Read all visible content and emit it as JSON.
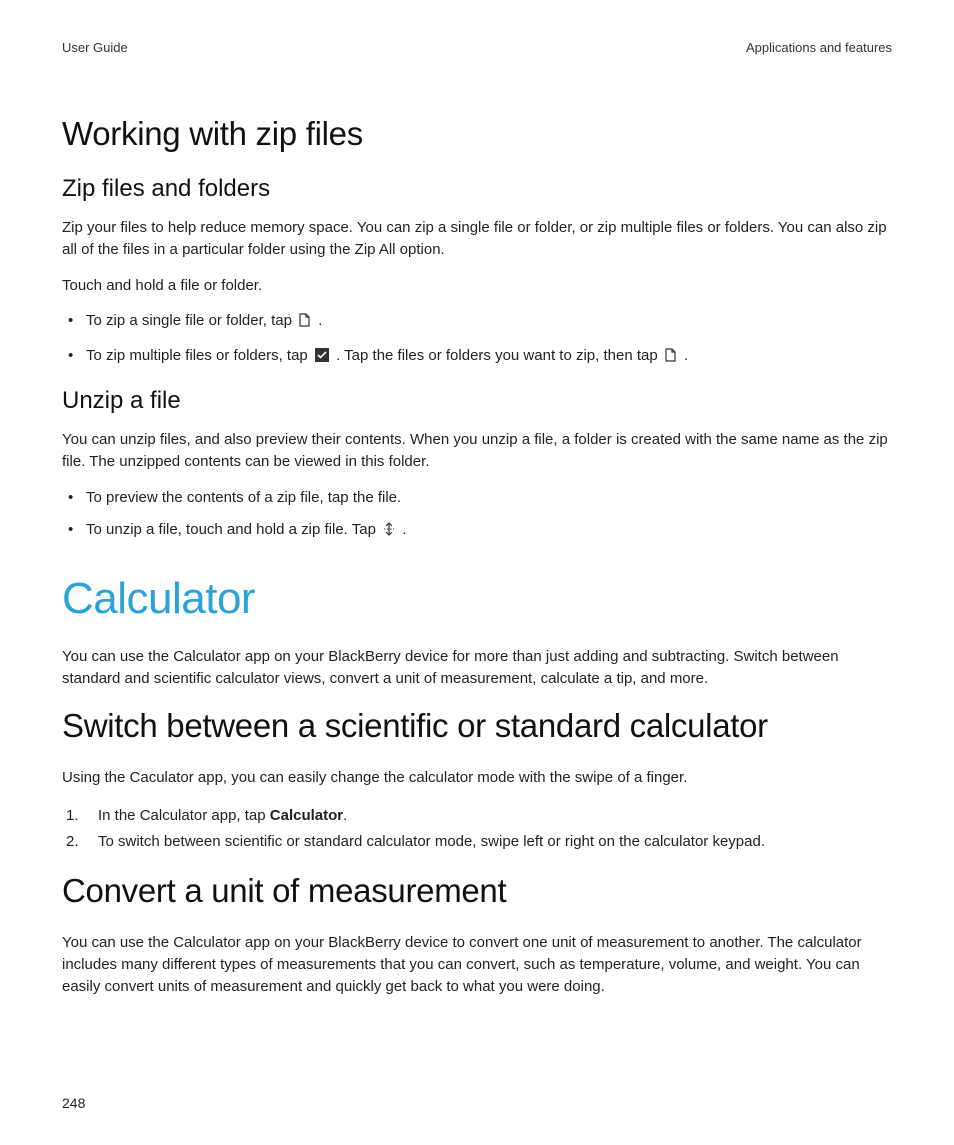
{
  "header": {
    "left": "User Guide",
    "right": "Applications and features"
  },
  "page_number": "248",
  "sections": {
    "zip": {
      "title": "Working with zip files",
      "sub1": {
        "title": "Zip files and folders",
        "p1": "Zip your files to help reduce memory space. You can zip a single file or folder, or zip multiple files or folders. You can also zip all of the files in a particular folder using the Zip All option.",
        "p2": "Touch and hold a file or folder.",
        "b1a": "To zip a single file or folder, tap ",
        "b1b": " .",
        "b2a": "To zip multiple files or folders, tap ",
        "b2b": " . Tap the files or folders you want to zip, then tap ",
        "b2c": " ."
      },
      "sub2": {
        "title": "Unzip a file",
        "p1": "You can unzip files, and also preview their contents. When you unzip a file, a folder is created with the same name as the zip file. The unzipped contents can be viewed in this folder.",
        "b1": "To preview the contents of a zip file, tap the file.",
        "b2a": "To unzip a file, touch and hold a zip file. Tap ",
        "b2b": " ."
      }
    },
    "calc": {
      "title": "Calculator",
      "p1": "You can use the Calculator app on your BlackBerry device for more than just adding and subtracting. Switch between standard and scientific calculator views, convert a unit of measurement, calculate a tip, and more.",
      "sub1": {
        "title": "Switch between a scientific or standard calculator",
        "p1": "Using the Caculator app, you can easily change the calculator mode with the swipe of a finger.",
        "s1a": "In the Calculator app, tap ",
        "s1b": "Calculator",
        "s1c": ".",
        "s2": "To switch between scientific or standard calculator mode, swipe left or right on the calculator keypad."
      },
      "sub2": {
        "title": "Convert a unit of measurement",
        "p1": "You can use the Calculator app on your BlackBerry device to convert one unit of measurement to another. The calculator includes many different types of measurements that you can convert, such as temperature, volume, and weight. You can easily convert units of measurement and quickly get back to what you were doing."
      }
    }
  }
}
